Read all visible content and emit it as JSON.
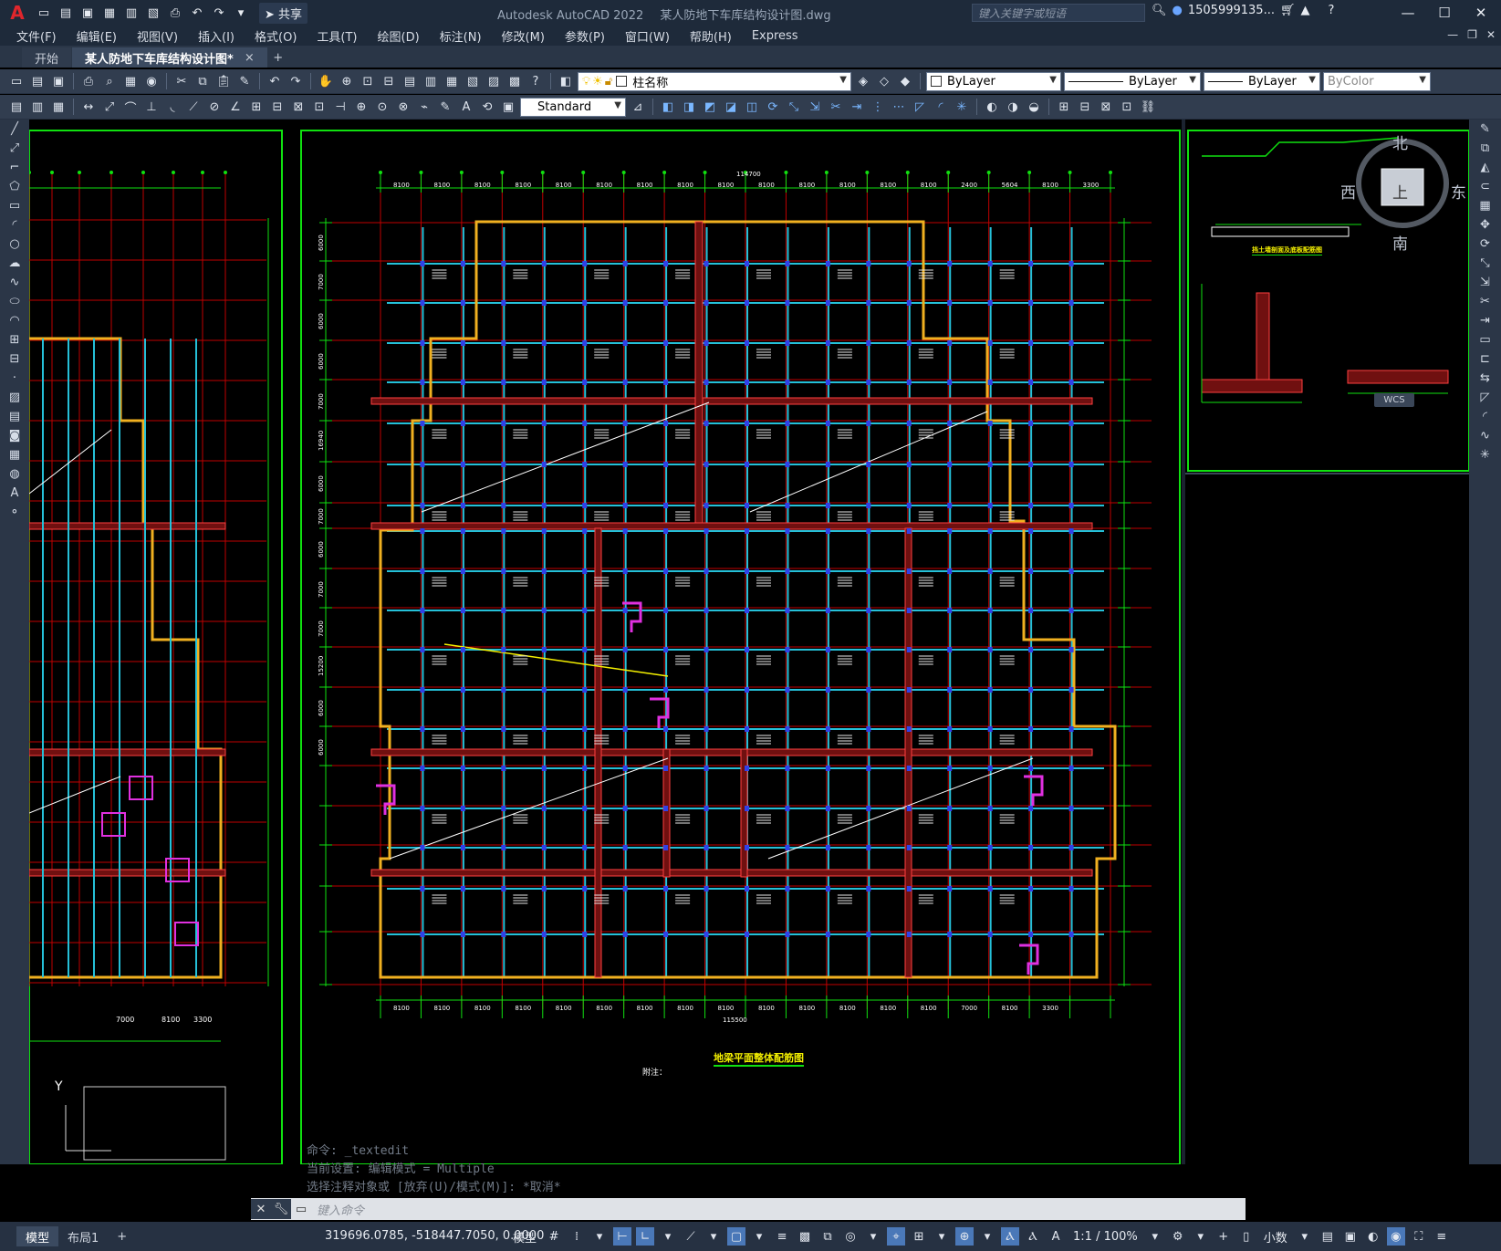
{
  "app": {
    "name": "Autodesk AutoCAD 2022",
    "document": "某人防地下车库结构设计图.dwg",
    "search_placeholder": "键入关键字或短语",
    "user": "1505999135...",
    "share_label": "共享"
  },
  "menu": [
    "文件(F)",
    "编辑(E)",
    "视图(V)",
    "插入(I)",
    "格式(O)",
    "工具(T)",
    "绘图(D)",
    "标注(N)",
    "修改(M)",
    "参数(P)",
    "窗口(W)",
    "帮助(H)",
    "Express"
  ],
  "tabs": [
    {
      "label": "开始"
    },
    {
      "label": "某人防地下车库结构设计图*",
      "close": "×"
    }
  ],
  "tab_add": "+",
  "toolbar_props": {
    "layer": "柱名称",
    "color": "ByLayer",
    "linetype": "ByLayer",
    "lineweight": "ByLayer",
    "plotstyle": "ByColor",
    "textstyle": "Standard"
  },
  "viewcube": {
    "north": "北",
    "south": "南",
    "east": "东",
    "west": "西",
    "top": "上",
    "wcs": "WCS"
  },
  "drawing": {
    "plan_title": "地梁平面整体配筋图",
    "notes_label": "附注：",
    "dims_top": [
      "8100",
      "8100",
      "8100",
      "8100",
      "8100",
      "8100",
      "8100",
      "8100",
      "8100",
      "8100",
      "8100",
      "8100",
      "8100",
      "8100",
      "2400",
      "5604",
      "8100",
      "3300"
    ],
    "dims_bottom": [
      "8100",
      "8100",
      "8100",
      "8100",
      "8100",
      "8100",
      "8100",
      "8100",
      "8100",
      "8100",
      "8100",
      "8100",
      "8100",
      "8100",
      "7000",
      "8100",
      "3300"
    ],
    "total_top": "114700",
    "total_bottom": "115500",
    "dims_left": [
      "6000",
      "7000",
      "6000",
      "6000",
      "7000",
      "16940",
      "6000",
      "7000",
      "6000",
      "7000",
      "7000",
      "15200",
      "6000",
      "6000"
    ],
    "left_partial_dims": [
      "7000",
      "8100",
      "3300"
    ],
    "detail_title": "挡土墙剖面及底板配筋图",
    "axis_y": "Y"
  },
  "command": {
    "history": [
      "命令: _textedit",
      "当前设置: 编辑模式 = Multiple",
      "选择注释对象或 [放弃(U)/模式(M)]: *取消*"
    ],
    "placeholder": "键入命令"
  },
  "layouts": [
    {
      "label": "模型"
    },
    {
      "label": "布局1"
    }
  ],
  "layout_add": "+",
  "status": {
    "coords": "319696.0785, -518447.7050, 0.0000",
    "model": "模型",
    "scale": "1:1 / 100%",
    "units": "小数"
  }
}
